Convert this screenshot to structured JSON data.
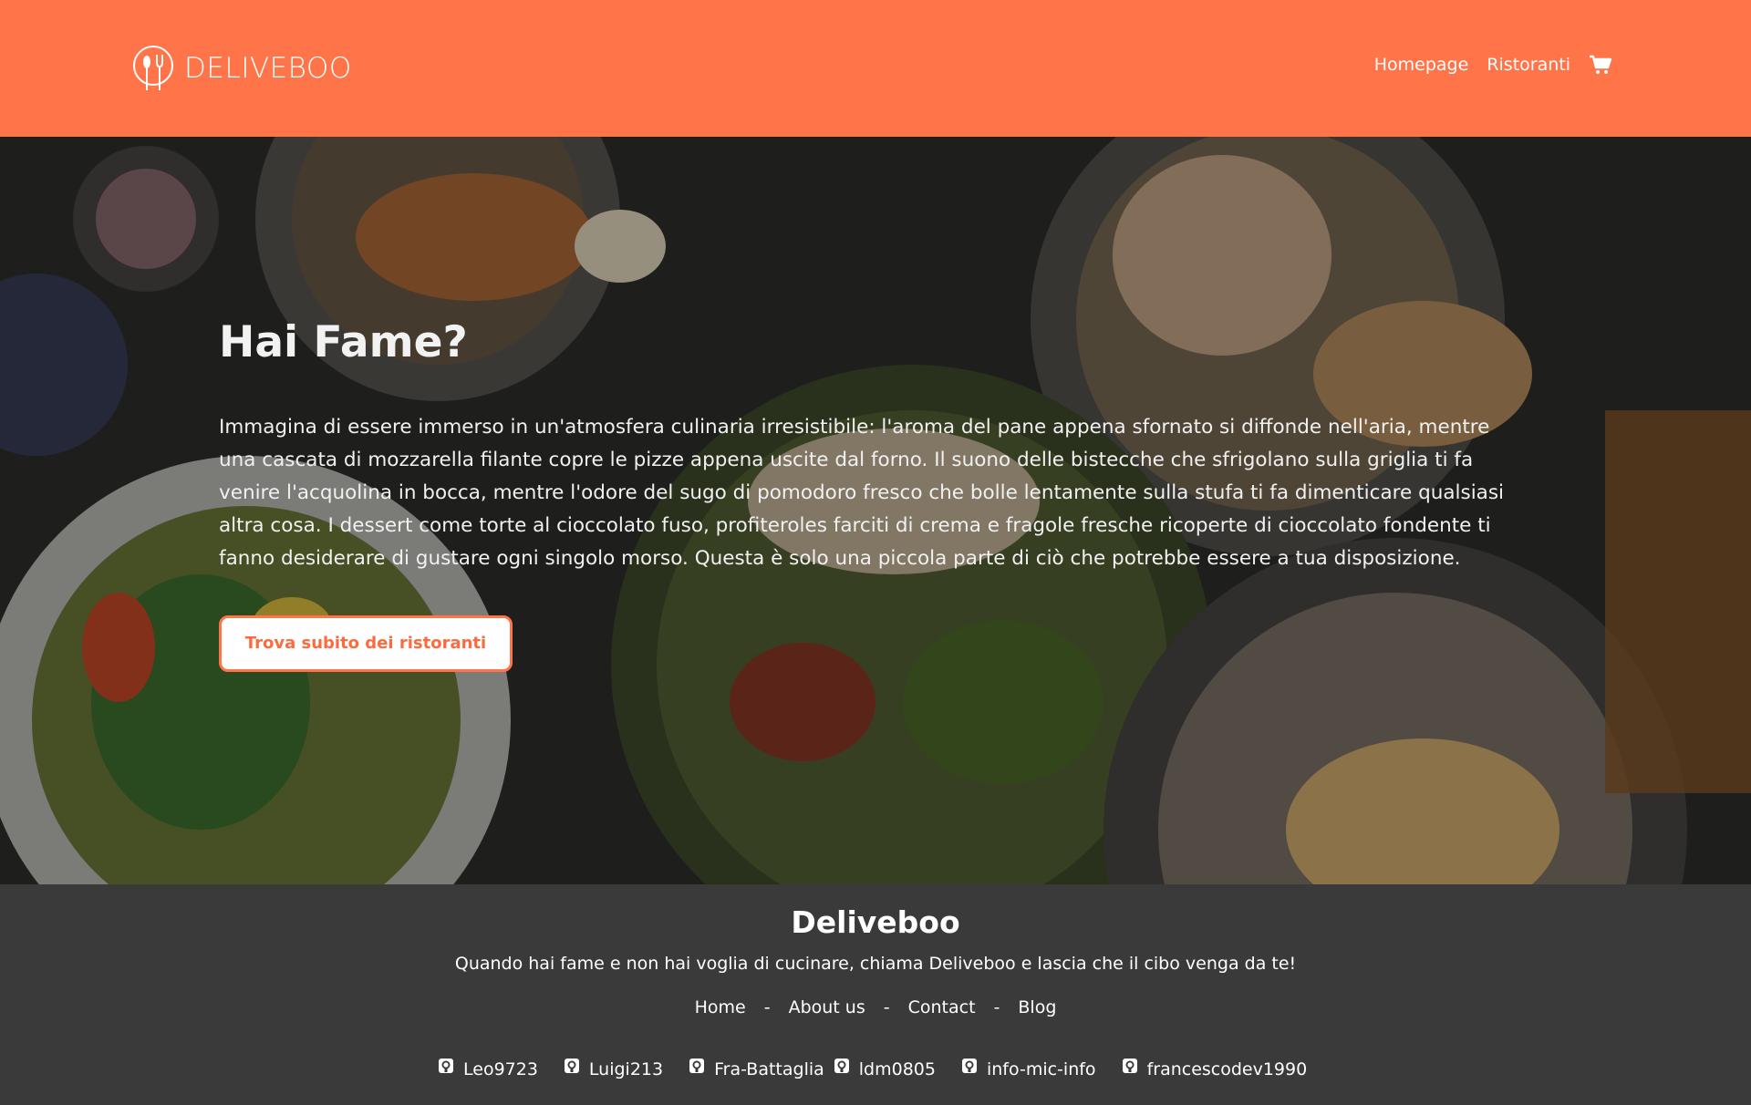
{
  "header": {
    "brand": "DELIVEBOO",
    "nav": [
      "Homepage",
      "Ristoranti"
    ],
    "bg_color": "#ff7448",
    "cart_icon": "cart-icon"
  },
  "hero": {
    "title": "Hai Fame?",
    "text": "Immagina di essere immerso in un'atmosfera culinaria irresistibile: l'aroma del pane appena sfornato si diffonde nell'aria, mentre una cascata di mozzarella filante copre le pizze appena uscite dal forno. Il suono delle bistecche che sfrigolano sulla griglia ti fa venire l'acquolina in bocca, mentre l'odore del sugo di pomodoro fresco che bolle lentamente sulla stufa ti fa dimenticare qualsiasi altra cosa. I dessert come torte al cioccolato fuso, profiteroles farciti di crema e fragole fresche ricoperte di cioccolato fondente ti fanno desiderare di gustare ogni singolo morso. Questa è solo una piccola parte di ciò che potrebbe essere a tua disposizione.",
    "button": "Trova subito dei ristoranti"
  },
  "footer": {
    "title": "Deliveboo",
    "tagline": "Quando hai fame e non hai voglia di cucinare, chiama Deliveboo e lascia che il cibo venga da te!",
    "links": [
      "Home",
      "About us",
      "Contact",
      "Blog"
    ],
    "separator": "-",
    "developers": [
      "Leo9723",
      "Luigi213",
      "Fra-Battaglia",
      "ldm0805",
      "info-mic-info",
      "francescodev1990"
    ],
    "dev_icon": "github-icon"
  }
}
